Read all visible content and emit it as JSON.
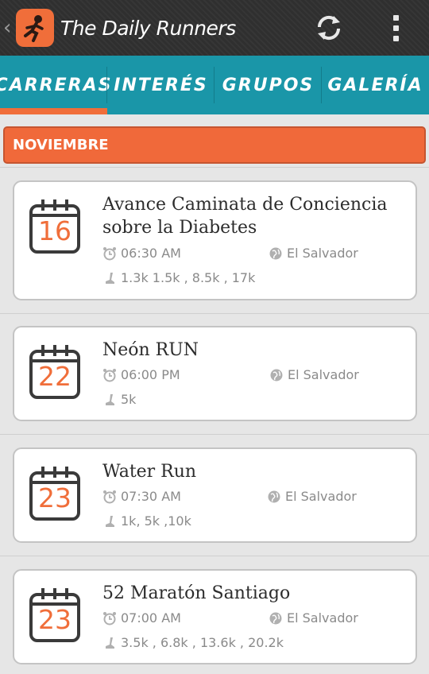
{
  "app": {
    "title": "The Daily Runners",
    "up_caret": "‹",
    "icons": {
      "logo": "runner-logo-icon",
      "refresh": "refresh-icon",
      "overflow": "overflow-menu-icon"
    }
  },
  "tabs": [
    {
      "label": "CARRERAS",
      "selected": true
    },
    {
      "label": "INTERÉS",
      "selected": false
    },
    {
      "label": "GRUPOS",
      "selected": false
    },
    {
      "label": "GALERÍA",
      "selected": false
    }
  ],
  "month": "NOVIEMBRE",
  "events": [
    {
      "day": "16",
      "title": "Avance Caminata de Conciencia sobre la Diabetes",
      "time": "06:30 AM",
      "country": "El Salvador",
      "distances": "1.3k 1.5k  , 8.5k , 17k"
    },
    {
      "day": "22",
      "title": "Neón RUN",
      "time": "06:00 PM",
      "country": "El Salvador",
      "distances": "5k"
    },
    {
      "day": "23",
      "title": "Water Run",
      "time": "07:30 AM",
      "country": "El Salvador",
      "distances": "1k, 5k ,10k"
    },
    {
      "day": "23",
      "title": "52 Maratón Santiago",
      "time": "07:00 AM",
      "country": "El Salvador",
      "distances": "3.5k , 6.8k , 13.6k , 20.2k"
    }
  ],
  "colors": {
    "accent": "#f06e3a",
    "tab_bar": "#1a96a8",
    "action_bar": "#2f2f2f"
  }
}
